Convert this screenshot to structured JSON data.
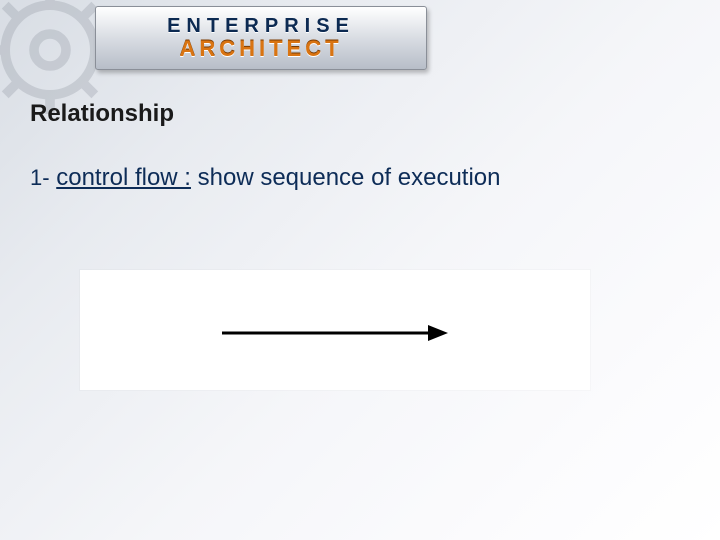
{
  "logo": {
    "line1": "ENTERPRISE",
    "line2": "ARCHITECT"
  },
  "heading": "Relationship",
  "bullet": {
    "number": "1-",
    "term": "control flow :",
    "description": " show sequence of execution"
  }
}
